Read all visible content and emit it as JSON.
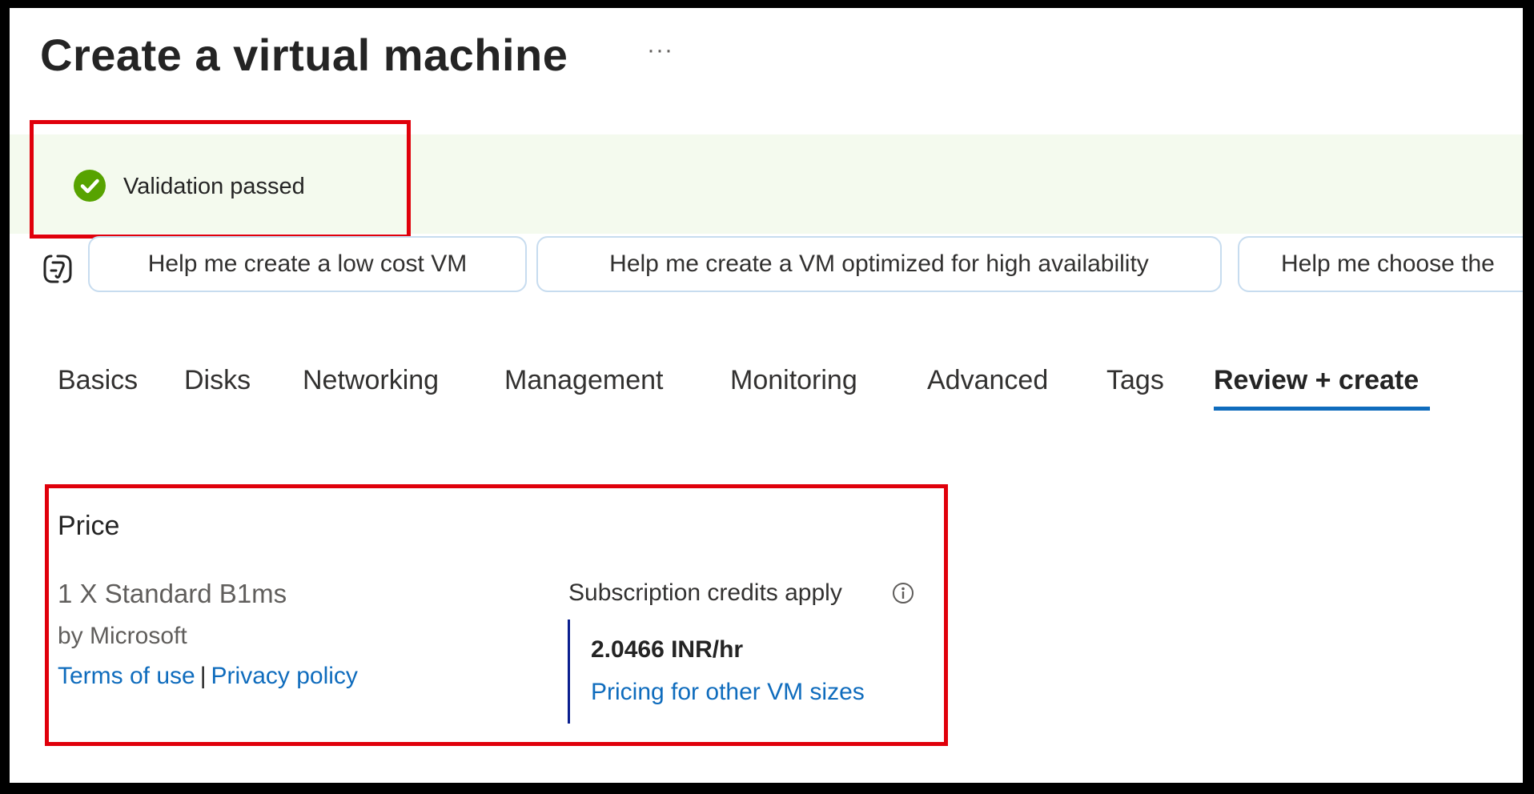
{
  "header": {
    "title": "Create a virtual machine",
    "more_label": "···"
  },
  "validation": {
    "text": "Validation passed",
    "status_color": "#57a300",
    "icon": "check-circle-icon"
  },
  "copilot": {
    "icon": "copilot-icon",
    "suggestions": [
      "Help me create a low cost VM",
      "Help me create a VM optimized for high availability",
      "Help me choose the"
    ]
  },
  "tabs": [
    {
      "label": "Basics",
      "active": false
    },
    {
      "label": "Disks",
      "active": false
    },
    {
      "label": "Networking",
      "active": false
    },
    {
      "label": "Management",
      "active": false
    },
    {
      "label": "Monitoring",
      "active": false
    },
    {
      "label": "Advanced",
      "active": false
    },
    {
      "label": "Tags",
      "active": false
    },
    {
      "label": "Review + create",
      "active": true
    }
  ],
  "price": {
    "heading": "Price",
    "product": "1 X Standard B1ms",
    "publisher": "by Microsoft",
    "terms_link": "Terms of use",
    "separator": "|",
    "privacy_link": "Privacy policy",
    "credits_label": "Subscription credits apply",
    "info_icon": "info-icon",
    "rate": "2.0466 INR/hr",
    "pricing_link": "Pricing for other VM sizes"
  },
  "colors": {
    "accent": "#0f6cbd",
    "highlight_box": "#e0000b",
    "banner_bg": "#f4faee"
  }
}
